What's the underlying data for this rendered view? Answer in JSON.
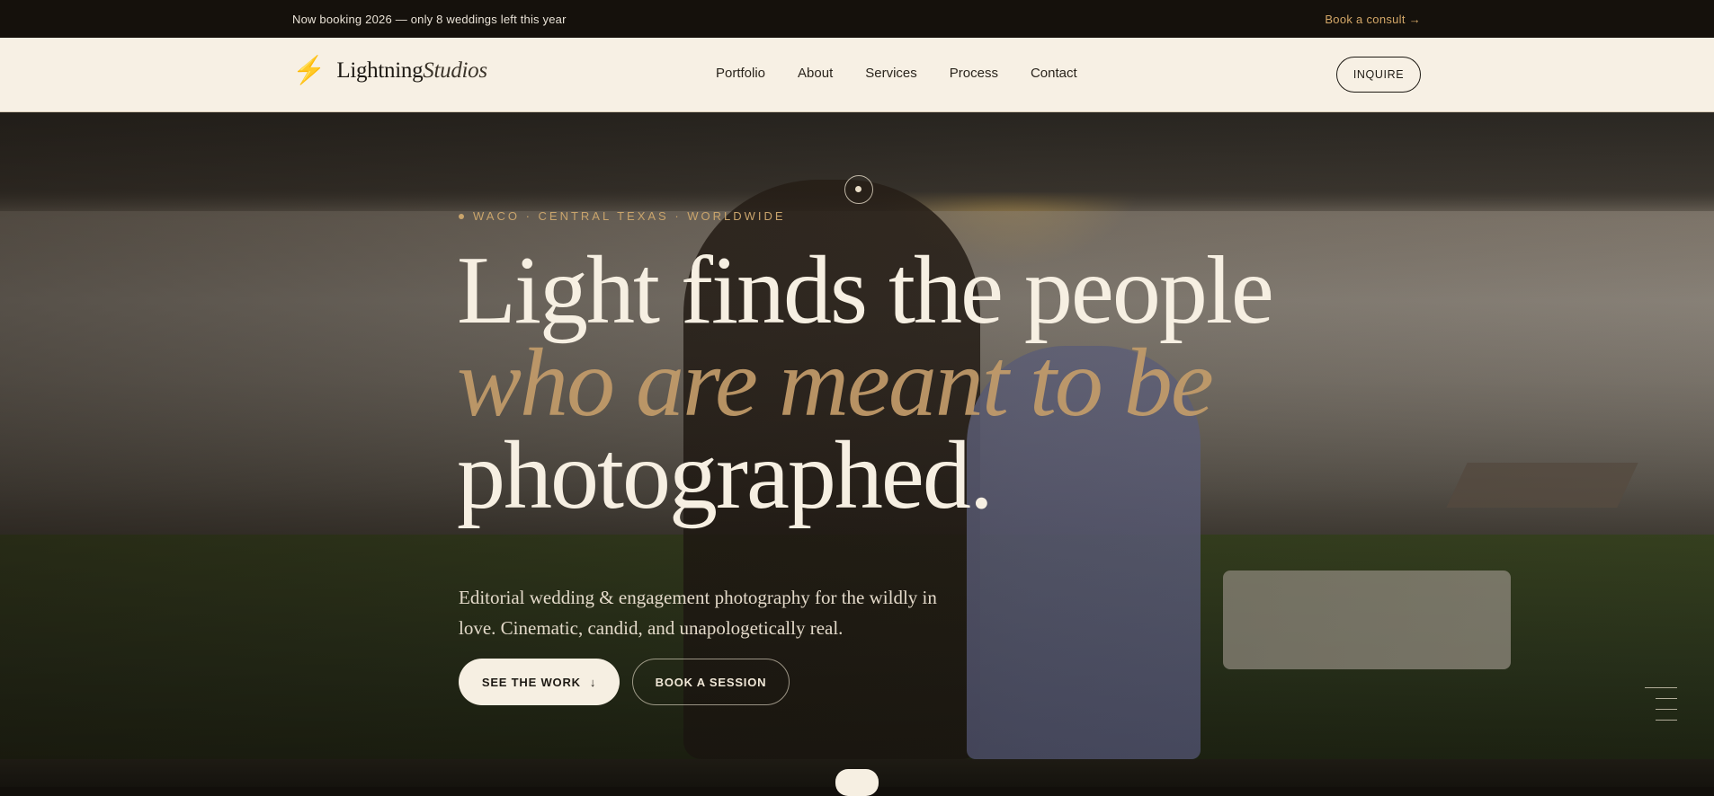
{
  "announcement": {
    "text": "Now booking 2026 — only 8 weddings left this year",
    "cta": "Book a consult →"
  },
  "header": {
    "logo": {
      "bolt": "⚡",
      "word": "Lightning",
      "italic": "Studios"
    },
    "nav": [
      "Portfolio",
      "About",
      "Services",
      "Process",
      "Contact"
    ],
    "inquire": "INQUIRE"
  },
  "hero": {
    "eyebrow": "WACO · CENTRAL TEXAS · WORLDWIDE",
    "headline_line1": "Light finds the people",
    "headline_line2": "who are meant to be",
    "headline_line3": "photographed.",
    "subhead": "Editorial wedding & engagement photography for the wildly in love. Cinematic, candid, and unapologetically real.",
    "primary_cta": "SEE THE WORK",
    "primary_cta_icon": "↓",
    "secondary_cta": "BOOK A SESSION"
  },
  "colors": {
    "accent_gold": "#c9a46c",
    "cream": "#f6efe2",
    "ink": "#15110c"
  }
}
